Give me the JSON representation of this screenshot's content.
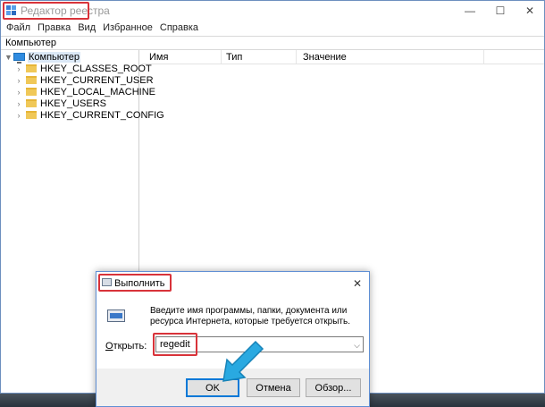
{
  "window": {
    "title": "Редактор реестра",
    "controls": {
      "minimize": "—",
      "maximize": "☐",
      "close": "✕"
    }
  },
  "menu": [
    "Файл",
    "Правка",
    "Вид",
    "Избранное",
    "Справка"
  ],
  "address": "Компьютер",
  "tree": {
    "root": "Компьютер",
    "children": [
      "HKEY_CLASSES_ROOT",
      "HKEY_CURRENT_USER",
      "HKEY_LOCAL_MACHINE",
      "HKEY_USERS",
      "HKEY_CURRENT_CONFIG"
    ]
  },
  "list": {
    "columns": [
      "Имя",
      "Тип",
      "Значение"
    ]
  },
  "run_dialog": {
    "title": "Выполнить",
    "close": "✕",
    "description": "Введите имя программы, папки, документа или ресурса Интернета, которые требуется открыть.",
    "open_label_underlined": "О",
    "open_label_rest": "ткрыть:",
    "input_value": "regedit",
    "buttons": {
      "ok": "OK",
      "cancel": "Отмена",
      "browse": "Обзор..."
    }
  },
  "colors": {
    "highlight": "#d8333a",
    "pointer": "#29a9e1"
  }
}
